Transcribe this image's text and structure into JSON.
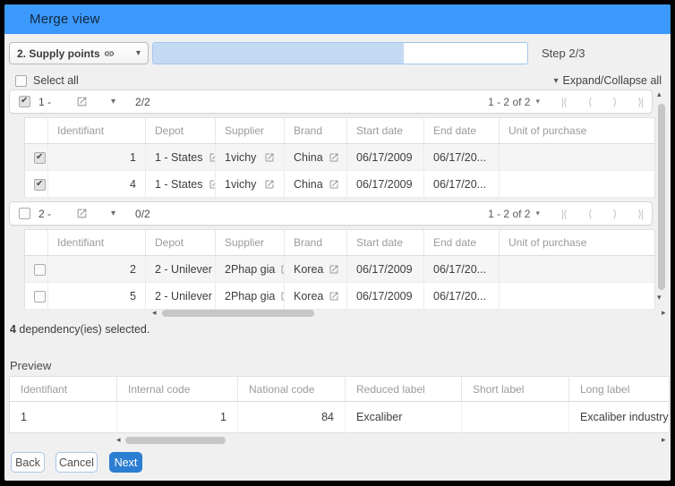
{
  "title_bar": {
    "title": "Merge view"
  },
  "toolbar": {
    "dropdown": {
      "label": "2. Supply points"
    },
    "progress": {
      "percent": 67
    },
    "step_label": "Step 2/3"
  },
  "list_controls": {
    "select_all": "Select all",
    "expand_collapse": "Expand/Collapse all"
  },
  "columns": [
    "Identifiant",
    "Depot",
    "Supplier",
    "Brand",
    "Start date",
    "End date",
    "Unit of purchase"
  ],
  "groups": [
    {
      "label": "1 -",
      "checked": true,
      "selected_count": "2/2",
      "pagination": {
        "range": "1 - 2 of 2"
      },
      "rows": [
        {
          "checked": true,
          "identifiant": "1",
          "depot": "1 - States",
          "supplier": "1vichy",
          "brand": "China",
          "start_date": "06/17/2009",
          "end_date": "06/17/20...",
          "unit_of_purchase": ""
        },
        {
          "checked": true,
          "identifiant": "4",
          "depot": "1 - States",
          "supplier": "1vichy",
          "brand": "China",
          "start_date": "06/17/2009",
          "end_date": "06/17/20...",
          "unit_of_purchase": ""
        }
      ]
    },
    {
      "label": "2 -",
      "checked": false,
      "selected_count": "0/2",
      "pagination": {
        "range": "1 - 2 of 2"
      },
      "rows": [
        {
          "checked": false,
          "identifiant": "2",
          "depot": "2 - Unilever",
          "supplier": "2Phap gia",
          "brand": "Korea",
          "start_date": "06/17/2009",
          "end_date": "06/17/20...",
          "unit_of_purchase": ""
        },
        {
          "checked": false,
          "identifiant": "5",
          "depot": "2 - Unilever",
          "supplier": "2Phap gia",
          "brand": "Korea",
          "start_date": "06/17/2009",
          "end_date": "06/17/20...",
          "unit_of_purchase": ""
        }
      ]
    }
  ],
  "status": {
    "count": "4",
    "text": " dependency(ies) selected."
  },
  "preview": {
    "label": "Preview",
    "columns": [
      "Identifiant",
      "Internal code",
      "National code",
      "Reduced label",
      "Short label",
      "Long label"
    ],
    "rows": [
      {
        "identifiant": "1",
        "internal_code": "1",
        "national_code": "84",
        "reduced_label": "Excaliber",
        "short_label": "",
        "long_label": "Excaliber industry"
      }
    ]
  },
  "footer": {
    "back": "Back",
    "cancel": "Cancel",
    "next": "Next"
  },
  "icons": {
    "caret_down": "▾",
    "first_page": "|⟨",
    "prev_page": "⟨",
    "next_page": "⟩",
    "last_page": "⟩|",
    "scroll_left": "◂",
    "scroll_right": "▸",
    "scroll_up": "▴",
    "scroll_down": "▾"
  },
  "colors": {
    "header_blue": "#3b99fc",
    "primary_button": "#2b7ed1",
    "progress_fill": "#c4d9f2"
  }
}
